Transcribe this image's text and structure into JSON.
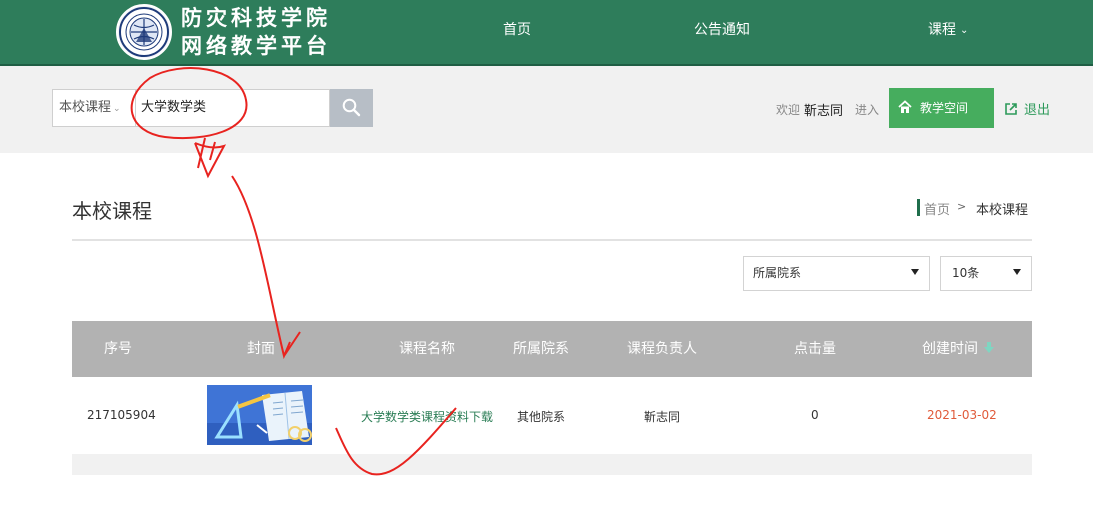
{
  "header": {
    "brand_line1": "防灾科技学院",
    "brand_line2": "网络教学平台",
    "nav": {
      "home": "首页",
      "notice": "公告通知",
      "course": "课程"
    },
    "bg_color": "#2e7d5b"
  },
  "search": {
    "scope": "本校课程",
    "query": "大学数学类"
  },
  "user": {
    "welcome": "欢迎",
    "name": "靳志同",
    "enter": "进入",
    "space_button": "教学空间",
    "logout": "退出"
  },
  "page": {
    "title": "本校课程",
    "breadcrumb": {
      "home": "首页",
      "separator": ">",
      "current": "本校课程"
    }
  },
  "filters": {
    "department": "所属院系",
    "page_size": "10条"
  },
  "table": {
    "headers": [
      "序号",
      "封面",
      "课程名称",
      "所属院系",
      "课程负责人",
      "点击量",
      "创建时间"
    ],
    "sort_icon": "sort-down-icon",
    "rows": [
      {
        "id": "217105904",
        "cover": "math-cover-image",
        "name": "大学数学类课程资料下载",
        "department": "其他院系",
        "owner": "靳志同",
        "clicks": "0",
        "created": "2021-03-02"
      }
    ]
  },
  "colors": {
    "primary_green": "#2e7d5b",
    "button_green": "#46ad5e",
    "link_green": "#2a7d55",
    "date_red": "#e05a3a",
    "annotation_red": "#e8231f"
  }
}
